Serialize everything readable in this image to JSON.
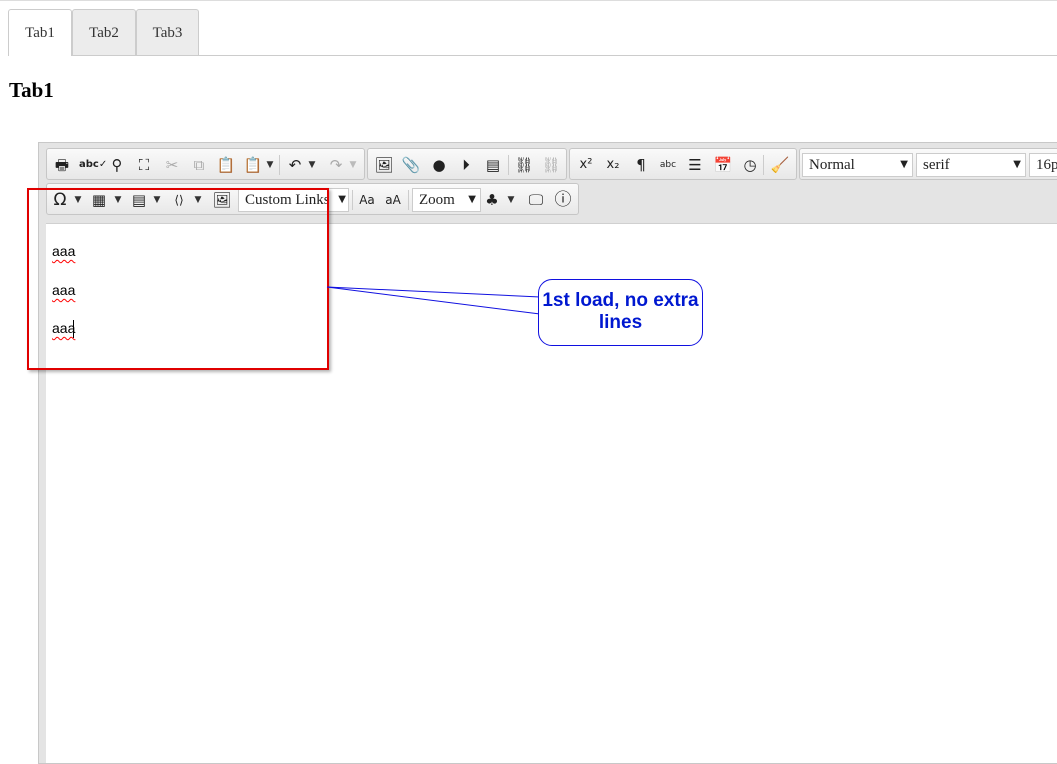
{
  "tabs": [
    {
      "label": "Tab1",
      "active": true
    },
    {
      "label": "Tab2",
      "active": false
    },
    {
      "label": "Tab3",
      "active": false
    }
  ],
  "heading": "Tab1",
  "toolbar": {
    "row1_icons": [
      "print-icon",
      "spellcheck-icon",
      "find-icon",
      "select-all-icon",
      "cut-icon",
      "copy-icon",
      "paste-icon",
      "paste-special-icon",
      "undo-icon",
      "redo-icon",
      "image-icon",
      "attachment-icon",
      "flash-icon",
      "media-icon",
      "template-icon",
      "link-icon",
      "unlink-icon",
      "superscript-icon",
      "subscript-icon",
      "paragraph-icon",
      "spellcheck-as-you-type-icon",
      "align-icon",
      "calendar-icon",
      "clock-icon",
      "remove-format-icon"
    ],
    "format_value": "Normal",
    "font_value": "serif",
    "size_value": "16p",
    "custom_links": "Custom Links",
    "zoom": "Zoom",
    "uppercase_label": "Aa",
    "lowercase_label": "aA",
    "glyph_omega": "Ω",
    "glyph_info": "ⓘ",
    "glyph_sup": "x²",
    "glyph_sub": "x₂"
  },
  "content": {
    "paragraphs": [
      "aaa",
      "aaa",
      "aaa"
    ]
  },
  "annotation": {
    "text": "1st load, no extra lines",
    "color": "#0018d0",
    "box_color": "#e00000"
  }
}
